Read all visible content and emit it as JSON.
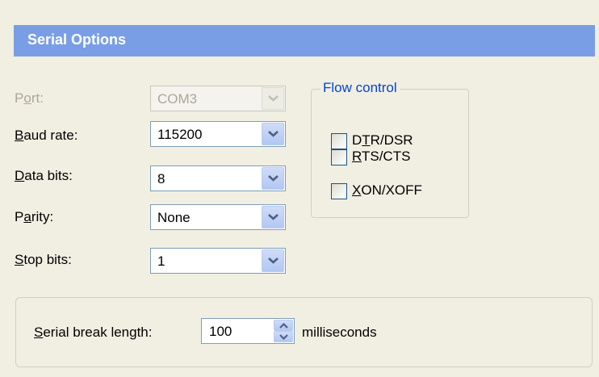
{
  "section": {
    "title": "Serial Options"
  },
  "fields": {
    "port": {
      "label_pre": "P",
      "label_u": "o",
      "label_post": "rt:",
      "value": "COM3"
    },
    "baud": {
      "label_pre": "",
      "label_u": "B",
      "label_post": "aud rate:",
      "value": "115200"
    },
    "data_bits": {
      "label_pre": "",
      "label_u": "D",
      "label_post": "ata bits:",
      "value": "8"
    },
    "parity": {
      "label_pre": "P",
      "label_u": "a",
      "label_post": "rity:",
      "value": "None"
    },
    "stop_bits": {
      "label_pre": "",
      "label_u": "S",
      "label_post": "top bits:",
      "value": "1"
    }
  },
  "flow_control": {
    "title": "Flow control",
    "options": [
      {
        "pre": "D",
        "u": "T",
        "post": "R/DSR",
        "checked": false
      },
      {
        "pre": "",
        "u": "R",
        "post": "TS/CTS",
        "checked": false
      },
      {
        "pre": "",
        "u": "X",
        "post": "ON/XOFF",
        "checked": false
      }
    ]
  },
  "break": {
    "label_pre": "",
    "label_u": "S",
    "label_post": "erial break length:",
    "value": "100",
    "unit": "milliseconds"
  },
  "colors": {
    "header": "#7a9ee6",
    "background": "#f1efe2",
    "group_title": "#0046d5"
  },
  "icons": {
    "dropdown": "chevron-down-icon",
    "spin_up": "arrow-up-icon",
    "spin_down": "arrow-down-icon"
  }
}
